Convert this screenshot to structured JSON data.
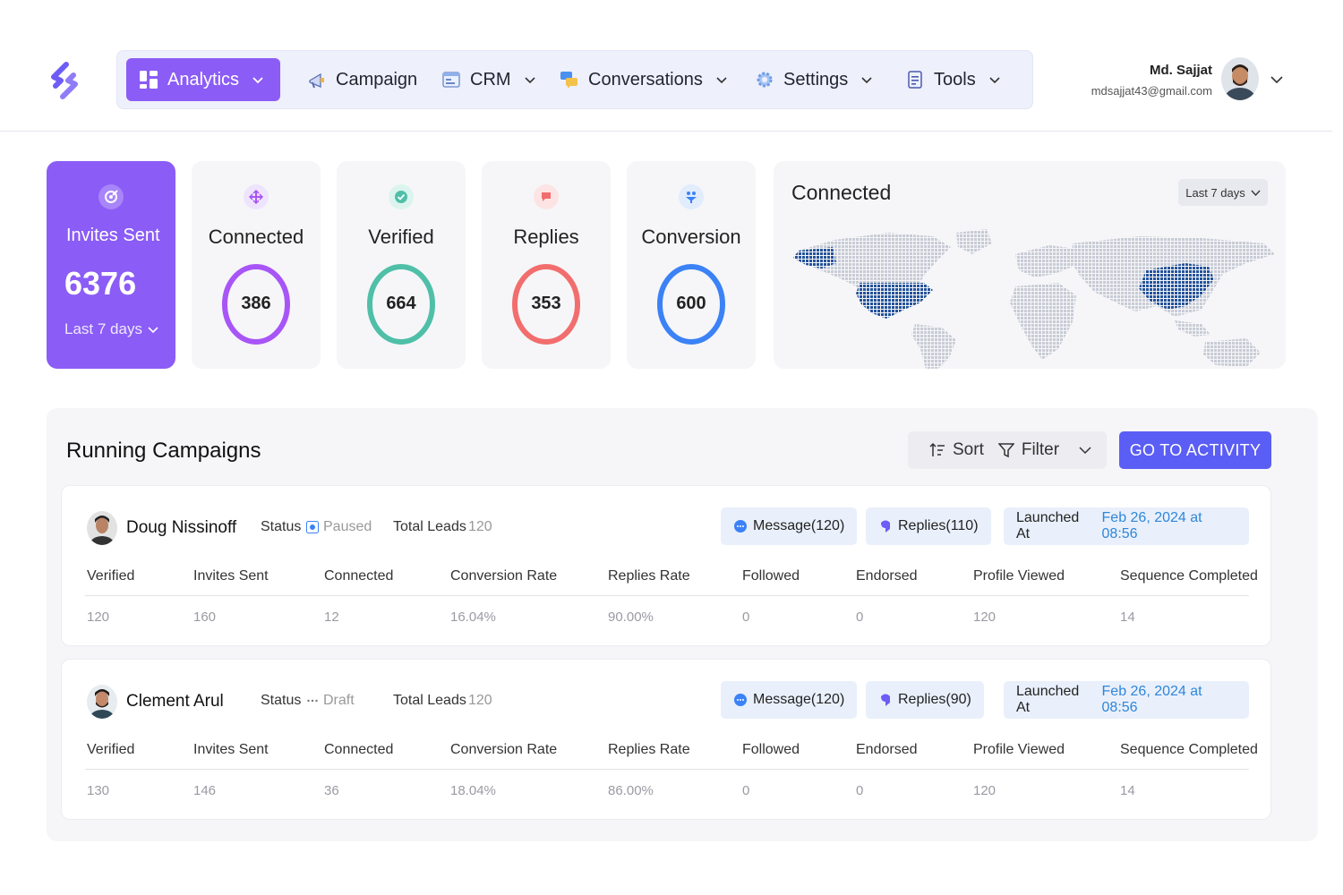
{
  "nav": {
    "items": [
      {
        "label": "Analytics",
        "icon": "dashboard-grid-icon",
        "active": true,
        "dropdown": true
      },
      {
        "label": "Campaign",
        "icon": "megaphone-icon",
        "active": false,
        "dropdown": false
      },
      {
        "label": "CRM",
        "icon": "crm-window-icon",
        "active": false,
        "dropdown": true
      },
      {
        "label": "Conversations",
        "icon": "chat-bubbles-icon",
        "active": false,
        "dropdown": true
      },
      {
        "label": "Settings",
        "icon": "gear-icon",
        "active": false,
        "dropdown": true
      },
      {
        "label": "Tools",
        "icon": "document-icon",
        "active": false,
        "dropdown": true
      }
    ]
  },
  "user": {
    "name": "Md. Sajjat",
    "email": "mdsajjat43@gmail.com"
  },
  "stats": {
    "invites": {
      "title": "Invites Sent",
      "value": "6376",
      "period": "Last 7 days"
    },
    "connected": {
      "title": "Connected",
      "value": "386",
      "color": "#a855f7"
    },
    "verified": {
      "title": "Verified",
      "value": "664",
      "color": "#4fbfa8"
    },
    "replies": {
      "title": "Replies",
      "value": "353",
      "color": "#f26d6d"
    },
    "conversion": {
      "title": "Conversion",
      "value": "600",
      "color": "#3b82f6"
    }
  },
  "map": {
    "title": "Connected",
    "period": "Last 7 days",
    "highlight_color": "#24539a",
    "base_color": "#c8ccd6"
  },
  "campaigns": {
    "title": "Running Campaigns",
    "sort_label": "Sort",
    "filter_label": "Filter",
    "go_label": "GO TO ACTIVITY",
    "headers": [
      "Verified",
      "Invites Sent",
      "Connected",
      "Conversion Rate",
      "Replies Rate",
      "Followed",
      "Endorsed",
      "Profile Viewed",
      "Sequence Completed"
    ],
    "items": [
      {
        "name": "Doug Nissinoff",
        "status_label": "Status",
        "status": "Paused",
        "total_leads_label": "Total Leads",
        "total_leads": "120",
        "message": "Message(120)",
        "replies": "Replies(110)",
        "launched_label": "Launched At",
        "launched": "Feb 26, 2024 at 08:56",
        "values": [
          "120",
          "160",
          "12",
          "16.04%",
          "90.00%",
          "0",
          "0",
          "120",
          "14"
        ]
      },
      {
        "name": "Clement Arul",
        "status_label": "Status",
        "status": "Draft",
        "total_leads_label": "Total Leads",
        "total_leads": "120",
        "message": "Message(120)",
        "replies": "Replies(90)",
        "launched_label": "Launched At",
        "launched": "Feb 26, 2024 at 08:56",
        "values": [
          "130",
          "146",
          "36",
          "18.04%",
          "86.00%",
          "0",
          "0",
          "120",
          "14"
        ]
      }
    ]
  }
}
